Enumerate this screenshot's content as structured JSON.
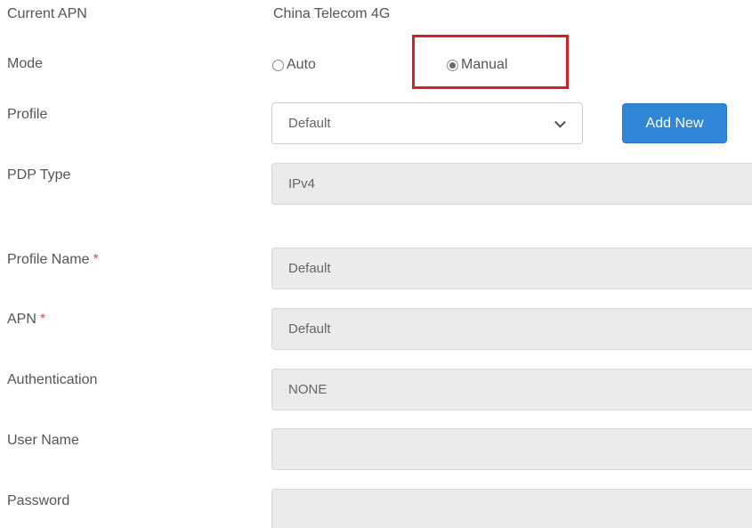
{
  "current_apn": {
    "label": "Current APN",
    "value": "China Telecom 4G"
  },
  "mode": {
    "label": "Mode",
    "options": [
      {
        "label": "Auto",
        "selected": false
      },
      {
        "label": "Manual",
        "selected": true
      }
    ]
  },
  "profile": {
    "label": "Profile",
    "selected": "Default",
    "add_button": "Add New"
  },
  "pdp_type": {
    "label": "PDP Type",
    "selected": "IPv4"
  },
  "profile_name": {
    "label": "Profile Name",
    "required_mark": "*",
    "value": "Default"
  },
  "apn": {
    "label": "APN",
    "required_mark": "*",
    "value": "Default"
  },
  "authentication": {
    "label": "Authentication",
    "selected": "NONE"
  },
  "user_name": {
    "label": "User Name",
    "value": ""
  },
  "password": {
    "label": "Password",
    "value": ""
  },
  "colors": {
    "highlight": "#d42027",
    "button": "#2f86d6",
    "required": "#d9534f"
  }
}
